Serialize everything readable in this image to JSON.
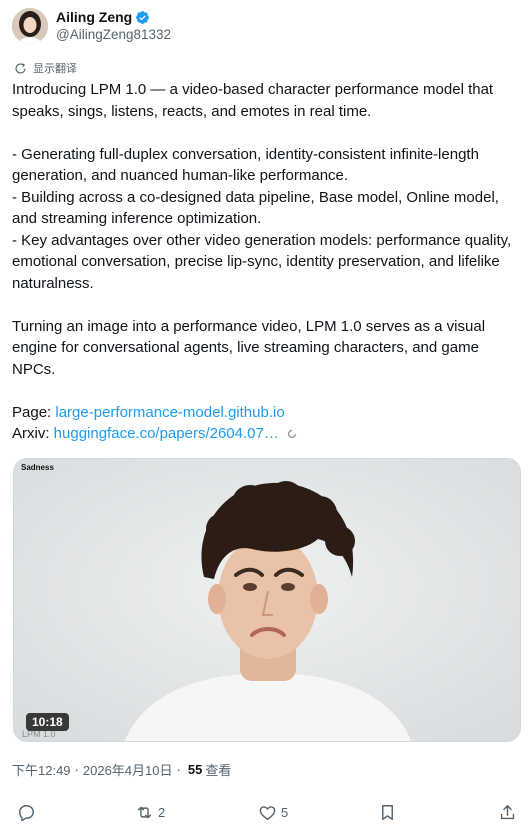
{
  "author": {
    "display_name": "Ailing Zeng",
    "handle": "@AilingZeng81332"
  },
  "translate_label": "显示翻译",
  "body": {
    "p1": "Introducing LPM 1.0 — a video-based character performance model that speaks, sings, listens, reacts, and emotes in real time.",
    "b1": "- Generating full-duplex conversation, identity-consistent infinite-length generation, and nuanced human-like performance.",
    "b2": "- Building across a co-designed data pipeline, Base model, Online model, and streaming inference optimization.",
    "b3": "- Key advantages over other video generation models: performance quality, emotional conversation, precise lip-sync, identity preservation, and lifelike naturalness.",
    "p2": "Turning an image into a performance video, LPM 1.0 serves as a visual engine for conversational agents, live streaming characters, and game NPCs.",
    "page_label": "Page: ",
    "page_link": "large-performance-model.github.io",
    "arxiv_label": "Arxiv: ",
    "arxiv_link": "huggingface.co/papers/2604.07…"
  },
  "media": {
    "label": "Sadness",
    "duration": "10:18",
    "watermark": "LPM 1.0"
  },
  "meta": {
    "time": "下午12:49",
    "date": "2026年4月10日",
    "views_count": "55",
    "views_label": "查看"
  },
  "actions": {
    "reply_count": "",
    "retweet_count": "2",
    "like_count": "5"
  },
  "colors": {
    "text": "#0f1419",
    "secondary": "#536471",
    "link": "#1d9bf0",
    "verified": "#1d9bf0"
  }
}
